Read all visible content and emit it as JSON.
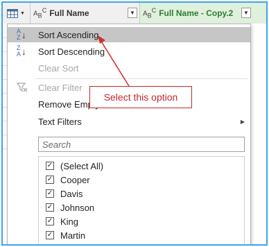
{
  "header": {
    "col1_title": "Full Name",
    "col2_title": "Full Name - Copy.2",
    "col_type_icon": "abc-text-type-icon",
    "dropdown_icon": "chevron-down-icon",
    "table_icon": "table-grid-icon"
  },
  "menu": {
    "sort_ascending": "Sort Ascending",
    "sort_descending": "Sort Descending",
    "clear_sort": "Clear Sort",
    "clear_filter": "Clear Filter",
    "remove_empty": "Remove Empty",
    "text_filters": "Text Filters",
    "search_placeholder": "Search",
    "values": [
      "(Select All)",
      "Cooper",
      "Davis",
      "Johnson",
      "King",
      "Martin"
    ]
  },
  "callout": {
    "text": "Select this option",
    "color": "#c62828"
  },
  "colors": {
    "frame": "#3aa4ef",
    "highlight": "#c6c6c6",
    "new_column_bg": "#dff0dc"
  }
}
